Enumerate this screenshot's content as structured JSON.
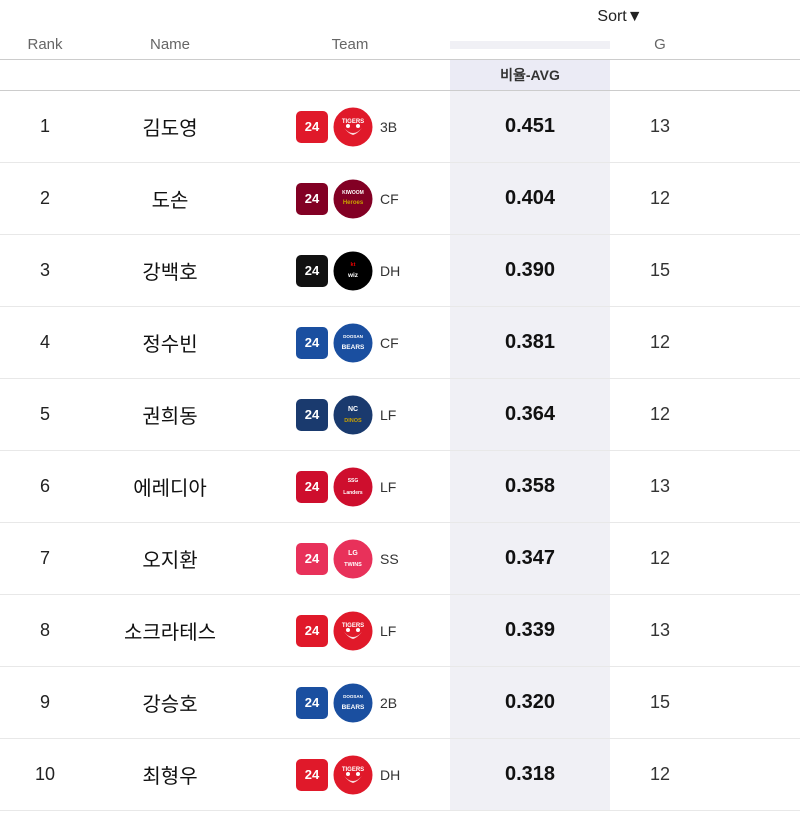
{
  "header": {
    "sort_label": "Sort",
    "sort_arrow": "▼",
    "columns": {
      "rank": "Rank",
      "name": "Name",
      "team": "Team",
      "avg": "비율-AVG",
      "g": "G"
    }
  },
  "rows": [
    {
      "rank": 1,
      "name": "김도영",
      "badge_class": "badge-tigers",
      "badge_num": "24",
      "team_name": "Tigers",
      "team_key": "tigers",
      "position": "3B",
      "avg": "0.451",
      "g": 13
    },
    {
      "rank": 2,
      "name": "도손",
      "badge_class": "badge-kiwoom",
      "badge_num": "24",
      "team_name": "Kiwoom",
      "team_key": "kiwoom",
      "position": "CF",
      "avg": "0.404",
      "g": 12
    },
    {
      "rank": 3,
      "name": "강백호",
      "badge_class": "badge-ktwiz",
      "badge_num": "24",
      "team_name": "KT Wiz",
      "team_key": "ktwiz",
      "position": "DH",
      "avg": "0.390",
      "g": 15
    },
    {
      "rank": 4,
      "name": "정수빈",
      "badge_class": "badge-doosan",
      "badge_num": "24",
      "team_name": "Bears",
      "team_key": "doosan",
      "position": "CF",
      "avg": "0.381",
      "g": 12
    },
    {
      "rank": 5,
      "name": "권희동",
      "badge_class": "badge-nc",
      "badge_num": "24",
      "team_name": "Dinos",
      "team_key": "nc",
      "position": "LF",
      "avg": "0.364",
      "g": 12
    },
    {
      "rank": 6,
      "name": "에레디아",
      "badge_class": "badge-ssg",
      "badge_num": "24",
      "team_name": "Landers",
      "team_key": "ssg",
      "position": "LF",
      "avg": "0.358",
      "g": 13
    },
    {
      "rank": 7,
      "name": "오지환",
      "badge_class": "badge-lg",
      "badge_num": "24",
      "team_name": "Twins",
      "team_key": "lg",
      "position": "SS",
      "avg": "0.347",
      "g": 12
    },
    {
      "rank": 8,
      "name": "소크라테스",
      "badge_class": "badge-tigers",
      "badge_num": "24",
      "team_name": "Tigers",
      "team_key": "tigers",
      "position": "LF",
      "avg": "0.339",
      "g": 13
    },
    {
      "rank": 9,
      "name": "강승호",
      "badge_class": "badge-doosan",
      "badge_num": "24",
      "team_name": "Bears",
      "team_key": "doosan",
      "position": "2B",
      "avg": "0.320",
      "g": 15
    },
    {
      "rank": 10,
      "name": "최형우",
      "badge_class": "badge-tigers",
      "badge_num": "24",
      "team_name": "Tigers",
      "team_key": "tigers",
      "position": "DH",
      "avg": "0.318",
      "g": 12
    }
  ]
}
